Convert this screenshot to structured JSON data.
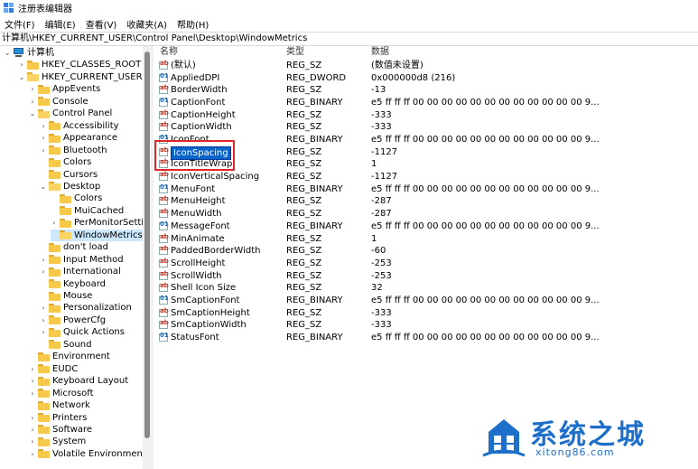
{
  "window": {
    "title": "注册表编辑器"
  },
  "menu": [
    "文件(F)",
    "编辑(E)",
    "查看(V)",
    "收藏夹(A)",
    "帮助(H)"
  ],
  "address": "计算机\\HKEY_CURRENT_USER\\Control Panel\\Desktop\\WindowMetrics",
  "tree": [
    {
      "label": "计算机",
      "level": 0,
      "chev": "v",
      "icon": "pc"
    },
    {
      "label": "HKEY_CLASSES_ROOT",
      "level": 1,
      "chev": ">",
      "icon": "folder"
    },
    {
      "label": "HKEY_CURRENT_USER",
      "level": 1,
      "chev": "v",
      "icon": "folder"
    },
    {
      "label": "AppEvents",
      "level": 2,
      "chev": ">",
      "icon": "folder"
    },
    {
      "label": "Console",
      "level": 2,
      "chev": ">",
      "icon": "folder"
    },
    {
      "label": "Control Panel",
      "level": 2,
      "chev": "v",
      "icon": "folder"
    },
    {
      "label": "Accessibility",
      "level": 3,
      "chev": ">",
      "icon": "folder"
    },
    {
      "label": "Appearance",
      "level": 3,
      "chev": ">",
      "icon": "folder"
    },
    {
      "label": "Bluetooth",
      "level": 3,
      "chev": ">",
      "icon": "folder"
    },
    {
      "label": "Colors",
      "level": 3,
      "chev": "",
      "icon": "folder"
    },
    {
      "label": "Cursors",
      "level": 3,
      "chev": "",
      "icon": "folder"
    },
    {
      "label": "Desktop",
      "level": 3,
      "chev": "v",
      "icon": "folder"
    },
    {
      "label": "Colors",
      "level": 4,
      "chev": "",
      "icon": "folder"
    },
    {
      "label": "MuiCached",
      "level": 4,
      "chev": "",
      "icon": "folder"
    },
    {
      "label": "PerMonitorSettin",
      "level": 4,
      "chev": ">",
      "icon": "folder"
    },
    {
      "label": "WindowMetrics",
      "level": 4,
      "chev": "",
      "icon": "folder",
      "selected": true
    },
    {
      "label": "don't load",
      "level": 3,
      "chev": "",
      "icon": "folder"
    },
    {
      "label": "Input Method",
      "level": 3,
      "chev": ">",
      "icon": "folder"
    },
    {
      "label": "International",
      "level": 3,
      "chev": ">",
      "icon": "folder"
    },
    {
      "label": "Keyboard",
      "level": 3,
      "chev": "",
      "icon": "folder"
    },
    {
      "label": "Mouse",
      "level": 3,
      "chev": "",
      "icon": "folder"
    },
    {
      "label": "Personalization",
      "level": 3,
      "chev": ">",
      "icon": "folder"
    },
    {
      "label": "PowerCfg",
      "level": 3,
      "chev": ">",
      "icon": "folder"
    },
    {
      "label": "Quick Actions",
      "level": 3,
      "chev": ">",
      "icon": "folder"
    },
    {
      "label": "Sound",
      "level": 3,
      "chev": "",
      "icon": "folder"
    },
    {
      "label": "Environment",
      "level": 2,
      "chev": "",
      "icon": "folder"
    },
    {
      "label": "EUDC",
      "level": 2,
      "chev": ">",
      "icon": "folder"
    },
    {
      "label": "Keyboard Layout",
      "level": 2,
      "chev": ">",
      "icon": "folder"
    },
    {
      "label": "Microsoft",
      "level": 2,
      "chev": ">",
      "icon": "folder"
    },
    {
      "label": "Network",
      "level": 2,
      "chev": "",
      "icon": "folder"
    },
    {
      "label": "Printers",
      "level": 2,
      "chev": ">",
      "icon": "folder"
    },
    {
      "label": "Software",
      "level": 2,
      "chev": ">",
      "icon": "folder"
    },
    {
      "label": "System",
      "level": 2,
      "chev": ">",
      "icon": "folder"
    },
    {
      "label": "Volatile Environment",
      "level": 2,
      "chev": ">",
      "icon": "folder"
    }
  ],
  "columns": {
    "name": "名称",
    "type": "类型",
    "data": "数据"
  },
  "values": [
    {
      "name": "(默认)",
      "type": "REG_SZ",
      "data": "(数值未设置)",
      "kind": "ab"
    },
    {
      "name": "AppliedDPI",
      "type": "REG_DWORD",
      "data": "0x000000d8 (216)",
      "kind": "bin"
    },
    {
      "name": "BorderWidth",
      "type": "REG_SZ",
      "data": "-13",
      "kind": "ab"
    },
    {
      "name": "CaptionFont",
      "type": "REG_BINARY",
      "data": "e5 ff ff ff 00 00 00 00 00 00 00 00 00 00 00 00 9...",
      "kind": "bin"
    },
    {
      "name": "CaptionHeight",
      "type": "REG_SZ",
      "data": "-333",
      "kind": "ab"
    },
    {
      "name": "CaptionWidth",
      "type": "REG_SZ",
      "data": "-333",
      "kind": "ab"
    },
    {
      "name": "IconFont",
      "type": "REG_BINARY",
      "data": "e5 ff ff ff 00 00 00 00 00 00 00 00 00 00 00 00 9...",
      "kind": "bin"
    },
    {
      "name": "IconSpacing",
      "type": "REG_SZ",
      "data": "-1127",
      "kind": "ab",
      "selected": true
    },
    {
      "name": "IconTitleWrap",
      "type": "REG_SZ",
      "data": "1",
      "kind": "ab"
    },
    {
      "name": "IconVerticalSpacing",
      "type": "REG_SZ",
      "data": "-1127",
      "kind": "ab"
    },
    {
      "name": "MenuFont",
      "type": "REG_BINARY",
      "data": "e5 ff ff ff 00 00 00 00 00 00 00 00 00 00 00 00 9...",
      "kind": "bin"
    },
    {
      "name": "MenuHeight",
      "type": "REG_SZ",
      "data": "-287",
      "kind": "ab"
    },
    {
      "name": "MenuWidth",
      "type": "REG_SZ",
      "data": "-287",
      "kind": "ab"
    },
    {
      "name": "MessageFont",
      "type": "REG_BINARY",
      "data": "e5 ff ff ff 00 00 00 00 00 00 00 00 00 00 00 00 9...",
      "kind": "bin"
    },
    {
      "name": "MinAnimate",
      "type": "REG_SZ",
      "data": "1",
      "kind": "ab"
    },
    {
      "name": "PaddedBorderWidth",
      "type": "REG_SZ",
      "data": "-60",
      "kind": "ab"
    },
    {
      "name": "ScrollHeight",
      "type": "REG_SZ",
      "data": "-253",
      "kind": "ab"
    },
    {
      "name": "ScrollWidth",
      "type": "REG_SZ",
      "data": "-253",
      "kind": "ab"
    },
    {
      "name": "Shell Icon Size",
      "type": "REG_SZ",
      "data": "32",
      "kind": "ab"
    },
    {
      "name": "SmCaptionFont",
      "type": "REG_BINARY",
      "data": "e5 ff ff ff 00 00 00 00 00 00 00 00 00 00 00 00 9...",
      "kind": "bin"
    },
    {
      "name": "SmCaptionHeight",
      "type": "REG_SZ",
      "data": "-333",
      "kind": "ab"
    },
    {
      "name": "SmCaptionWidth",
      "type": "REG_SZ",
      "data": "-333",
      "kind": "ab"
    },
    {
      "name": "StatusFont",
      "type": "REG_BINARY",
      "data": "e5 ff ff ff 00 00 00 00 00 00 00 00 00 00 00 00 9...",
      "kind": "bin"
    }
  ],
  "watermark": {
    "text": "系统之城",
    "url": "xitong86.com"
  },
  "colors": {
    "selection": "#0a64c8",
    "highlight_box": "#e0262a",
    "watermark": "#1e6fc9"
  }
}
